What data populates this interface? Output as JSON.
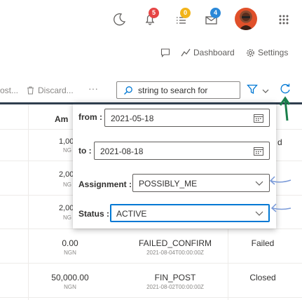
{
  "topbar": {
    "notifications_count": "5",
    "tasks_count": "0",
    "messages_count": "4",
    "colors": {
      "red_badge": "#e64545",
      "yellow_badge": "#f2b41a",
      "blue_badge": "#2b88d8"
    }
  },
  "subbar": {
    "dashboard_label": "Dashboard",
    "settings_label": "Settings"
  },
  "toolbar": {
    "post_label": "ost...",
    "discard_label": "Discard...",
    "more_label": "···",
    "search_value": "string to search for"
  },
  "table": {
    "amount_header": "Am",
    "rows": [
      {
        "amount": "1,00",
        "currency": "NG",
        "status": "d"
      },
      {
        "amount": "2,00",
        "currency": "NG",
        "status": ""
      },
      {
        "amount": "2,00",
        "currency": "NG",
        "status": ""
      },
      {
        "amount": "0.00",
        "currency": "NGN",
        "type": "FAILED_CONFIRM",
        "date": "2021-08-04T00:00:00Z",
        "status": "Failed"
      },
      {
        "amount": "50,000.00",
        "currency": "NGN",
        "type": "FIN_POST",
        "date": "2021-08-02T00:00:00Z",
        "status": "Closed"
      }
    ]
  },
  "filter": {
    "from_label": "from :",
    "from_value": "2021-05-18",
    "to_label": "to :",
    "to_value": "2021-08-18",
    "assignment_label": "Assignment :",
    "assignment_value": "POSSIBLY_ME",
    "status_label": "Status :",
    "status_value": "ACTIVE"
  }
}
